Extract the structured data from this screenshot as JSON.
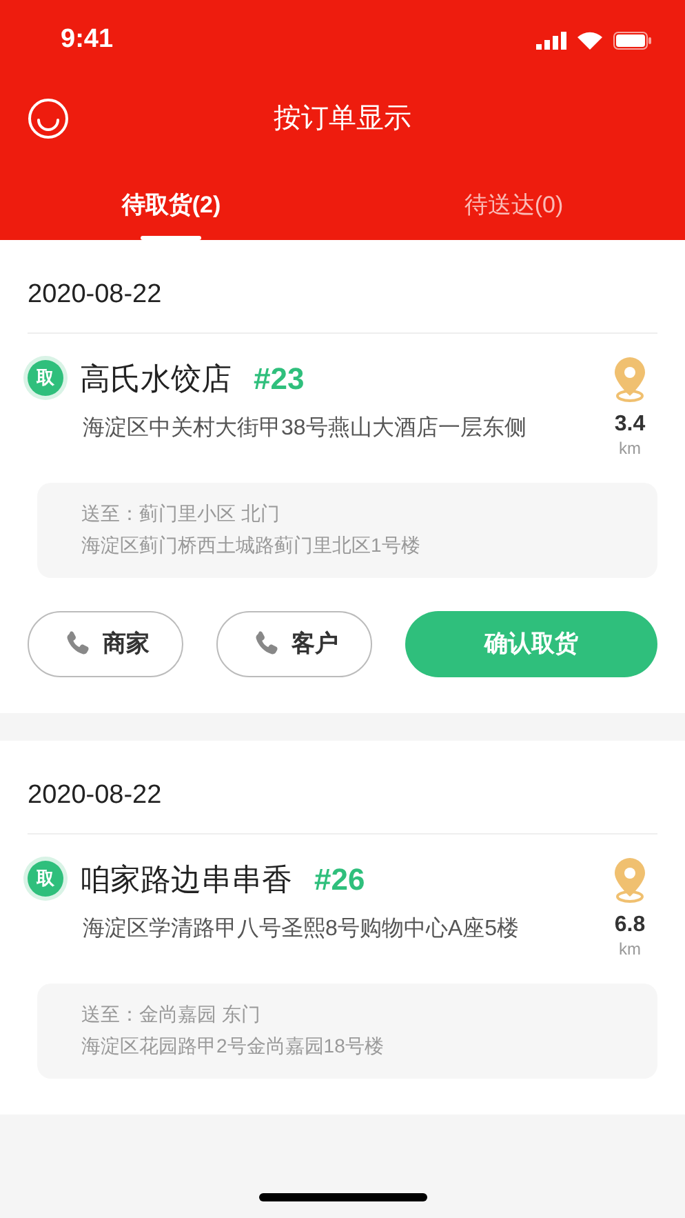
{
  "status_bar": {
    "time": "9:41"
  },
  "header": {
    "title": "按订单显示"
  },
  "tabs": [
    {
      "label": "待取货(2)",
      "selected": true
    },
    {
      "label": "待送达(0)",
      "selected": false
    }
  ],
  "orders": [
    {
      "date": "2020-08-22",
      "badge": "取",
      "shop": "高氏水饺店",
      "number": "#23",
      "address": "海淀区中关村大街甲38号燕山大酒店一层东侧",
      "distance": "3.4",
      "unit": "km",
      "deliver_to": "送至：蓟门里小区 北门",
      "deliver_address": "海淀区蓟门桥西土城路蓟门里北区1号楼",
      "actions": [
        {
          "kind": "call",
          "label": "商家"
        },
        {
          "kind": "call",
          "label": "客户"
        },
        {
          "kind": "confirm",
          "label": "确认取货"
        }
      ]
    },
    {
      "date": "2020-08-22",
      "badge": "取",
      "shop": "咱家路边串串香",
      "number": "#26",
      "address": "海淀区学清路甲八号圣熙8号购物中心A座5楼",
      "distance": "6.8",
      "unit": "km",
      "deliver_to": "送至：金尚嘉园 东门",
      "deliver_address": "海淀区花园路甲2号金尚嘉园18号楼"
    }
  ]
}
